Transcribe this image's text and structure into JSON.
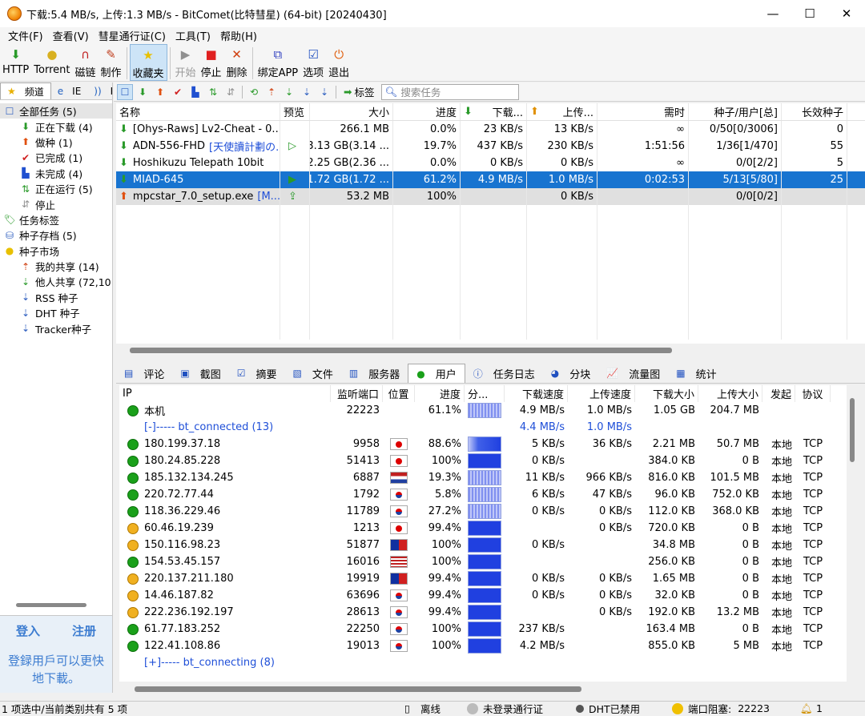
{
  "window": {
    "title": "下载:5.4 MB/s, 上传:1.3 MB/s - BitComet(比特彗星) (64-bit) [20240430]",
    "minimize": "—",
    "maximize": "☐",
    "close": "✕"
  },
  "menu": [
    "文件(F)",
    "查看(V)",
    "彗星通行证(C)",
    "工具(T)",
    "帮助(H)"
  ],
  "toolbar": [
    {
      "label": "HTTP",
      "icon": "http-download-icon",
      "glyph": "⬇",
      "color": "#2a9a2a",
      "state": "normal"
    },
    {
      "label": "Torrent",
      "icon": "torrent-icon",
      "glyph": "●",
      "color": "#d8b020",
      "state": "normal"
    },
    {
      "label": "磁链",
      "icon": "magnet-icon",
      "glyph": "∩",
      "color": "#c02020",
      "state": "normal"
    },
    {
      "label": "制作",
      "icon": "make-torrent-icon",
      "glyph": "✎",
      "color": "#c04020",
      "state": "normal"
    },
    {
      "label": "收藏夹",
      "icon": "favorites-star-icon",
      "glyph": "★",
      "color": "#e8c000",
      "state": "active"
    },
    {
      "label": "开始",
      "icon": "start-icon",
      "glyph": "▶",
      "color": "#909090",
      "state": "disabled"
    },
    {
      "label": "停止",
      "icon": "stop-icon",
      "glyph": "■",
      "color": "#e02020",
      "state": "normal"
    },
    {
      "label": "删除",
      "icon": "delete-icon",
      "glyph": "✕",
      "color": "#d04010",
      "state": "normal"
    },
    {
      "label": "绑定APP",
      "icon": "bind-app-icon",
      "glyph": "⧉",
      "color": "#3040c0",
      "state": "normal"
    },
    {
      "label": "选项",
      "icon": "options-icon",
      "glyph": "☑",
      "color": "#2050c0",
      "state": "normal"
    },
    {
      "label": "退出",
      "icon": "exit-icon",
      "glyph": "⏻",
      "color": "#e06010",
      "state": "normal"
    }
  ],
  "left_tabs": [
    {
      "label": "频道",
      "icon": "star-icon",
      "glyph": "★",
      "sel": true
    },
    {
      "label": "IE",
      "icon": "ie-icon",
      "glyph": "e",
      "sel": false
    },
    {
      "label": "RSS",
      "icon": "rss-icon",
      "glyph": "))",
      "sel": false
    }
  ],
  "tree": [
    {
      "label": "全部任务 (5)",
      "indent": 4,
      "icon": "all-tasks-icon",
      "glyph": "☐",
      "color": "#3060c0",
      "sel": true
    },
    {
      "label": "正在下载 (4)",
      "indent": 24,
      "icon": "downloading-icon",
      "glyph": "⬇",
      "color": "#2a9a2a",
      "sel": false
    },
    {
      "label": "做种 (1)",
      "indent": 24,
      "icon": "seeding-icon",
      "glyph": "⬆",
      "color": "#e05010",
      "sel": false
    },
    {
      "label": "已完成 (1)",
      "indent": 24,
      "icon": "completed-icon",
      "glyph": "✔",
      "color": "#d02020",
      "sel": false
    },
    {
      "label": "未完成 (4)",
      "indent": 24,
      "icon": "incomplete-icon",
      "glyph": "▙",
      "color": "#2050d0",
      "sel": false
    },
    {
      "label": "正在运行 (5)",
      "indent": 24,
      "icon": "running-icon",
      "glyph": "⇅",
      "color": "#2a9a2a",
      "sel": false
    },
    {
      "label": "停止",
      "indent": 24,
      "icon": "stopped-icon",
      "glyph": "⇵",
      "color": "#909090",
      "sel": false
    },
    {
      "label": "任务标签",
      "indent": 4,
      "icon": "task-tag-icon",
      "glyph": "🏷",
      "color": "#2a9a2a",
      "sel": false
    },
    {
      "label": "种子存档 (5)",
      "indent": 4,
      "icon": "torrent-archive-icon",
      "glyph": "⛁",
      "color": "#3060c0",
      "sel": false
    },
    {
      "label": "种子市场",
      "indent": 4,
      "icon": "torrent-market-icon",
      "glyph": "●",
      "color": "#e8c000",
      "sel": false
    },
    {
      "label": "我的共享 (14)",
      "indent": 24,
      "icon": "my-share-icon",
      "glyph": "⇡",
      "color": "#d04010",
      "sel": false
    },
    {
      "label": "他人共享 (72,10",
      "indent": 24,
      "icon": "others-share-icon",
      "glyph": "⇣",
      "color": "#2a9a2a",
      "sel": false
    },
    {
      "label": "RSS 种子",
      "indent": 24,
      "icon": "rss-seeds-icon",
      "glyph": "⇣",
      "color": "#3060c0",
      "sel": false
    },
    {
      "label": "DHT 种子",
      "indent": 24,
      "icon": "dht-seeds-icon",
      "glyph": "⇣",
      "color": "#3060c0",
      "sel": false
    },
    {
      "label": "Tracker种子",
      "indent": 24,
      "icon": "tracker-seeds-icon",
      "glyph": "⇣",
      "color": "#3060c0",
      "sel": false
    }
  ],
  "login": {
    "login": "登入",
    "register": "注册",
    "message": "登録用戶可以更快地下載。"
  },
  "filter_icons": [
    {
      "name": "filter-all-icon",
      "glyph": "☐",
      "color": "#3060c0",
      "sel": true
    },
    {
      "name": "filter-downloading-icon",
      "glyph": "⬇",
      "color": "#2a9a2a",
      "sel": false
    },
    {
      "name": "filter-seeding-icon",
      "glyph": "⬆",
      "color": "#e05010",
      "sel": false
    },
    {
      "name": "filter-completed-icon",
      "glyph": "✔",
      "color": "#d02020",
      "sel": false
    },
    {
      "name": "filter-incomplete-icon",
      "glyph": "▙",
      "color": "#2050d0",
      "sel": false
    },
    {
      "name": "filter-running-icon",
      "glyph": "⇅",
      "color": "#2a9a2a",
      "sel": false
    },
    {
      "name": "filter-stopped-icon",
      "glyph": "⇵",
      "color": "#909090",
      "sel": false
    },
    {
      "name": "filter-share-icon",
      "glyph": "⟲",
      "color": "#2a9a2a",
      "sel": false
    },
    {
      "name": "filter-my-share-icon",
      "glyph": "⇡",
      "color": "#d04010",
      "sel": false
    },
    {
      "name": "filter-others-share-icon",
      "glyph": "⇣",
      "color": "#2a9a2a",
      "sel": false
    },
    {
      "name": "filter-rss-icon",
      "glyph": "⇣",
      "color": "#3060c0",
      "sel": false
    },
    {
      "name": "filter-dht-icon",
      "glyph": "⇣",
      "color": "#3060c0",
      "sel": false
    }
  ],
  "filter_tag": "标签",
  "search": {
    "placeholder": "搜索任务"
  },
  "task_columns": [
    {
      "label": "名称",
      "w": 205,
      "align": "l"
    },
    {
      "label": "预览",
      "w": 37,
      "align": "l"
    },
    {
      "label": "大小",
      "w": 104,
      "align": "r"
    },
    {
      "label": "进度",
      "w": 84,
      "align": "r"
    },
    {
      "label": "下载...",
      "w": 83,
      "align": "r",
      "icon": "⬇"
    },
    {
      "label": "上传...",
      "w": 88,
      "align": "r",
      "icon": "⬆"
    },
    {
      "label": "需时",
      "w": 114,
      "align": "r"
    },
    {
      "label": "种子/用户[总]",
      "w": 116,
      "align": "r"
    },
    {
      "label": "长效种子",
      "w": 82,
      "align": "r"
    }
  ],
  "tasks": [
    {
      "name": "[Ohys-Raws] Lv2-Cheat - 0...",
      "tag": "",
      "preview": "",
      "size": "266.1 MB",
      "progress": "0.0%",
      "down": "23 KB/s",
      "up": "13 KB/s",
      "eta": "∞",
      "seeds": "0/50[0/3006]",
      "long": "0",
      "icon": "⬇",
      "iconcolor": "#2a9a2a",
      "state": ""
    },
    {
      "name": "ADN-556-FHD",
      "tag": "[天使讀計劃の...",
      "preview": "▷",
      "size": "3.13 GB(3.14 ...",
      "progress": "19.7%",
      "down": "437 KB/s",
      "up": "230 KB/s",
      "eta": "1:51:56",
      "seeds": "1/36[1/470]",
      "long": "55",
      "icon": "⬇",
      "iconcolor": "#2a9a2a",
      "state": ""
    },
    {
      "name": "Hoshikuzu Telepath 10bit",
      "tag": "",
      "preview": "",
      "size": "2.25 GB(2.36 ...",
      "progress": "0.0%",
      "down": "0 KB/s",
      "up": "0 KB/s",
      "eta": "∞",
      "seeds": "0/0[2/2]",
      "long": "5",
      "icon": "⬇",
      "iconcolor": "#2a9a2a",
      "state": ""
    },
    {
      "name": "MIAD-645",
      "tag": "",
      "preview": "▶",
      "size": "1.72 GB(1.72 ...",
      "progress": "61.2%",
      "down": "4.9 MB/s",
      "up": "1.0 MB/s",
      "eta": "0:02:53",
      "seeds": "5/13[5/80]",
      "long": "25",
      "icon": "⬇",
      "iconcolor": "#2a9a2a",
      "state": "sel"
    },
    {
      "name": "mpcstar_7.0_setup.exe",
      "tag": "[M...",
      "preview": "⇪",
      "size": "53.2 MB",
      "progress": "100%",
      "down": "",
      "up": "0 KB/s",
      "eta": "",
      "seeds": "0/0[0/2]",
      "long": "",
      "icon": "⬆",
      "iconcolor": "#e05010",
      "state": "sel2"
    }
  ],
  "detail_tabs": [
    {
      "label": "评论",
      "icon": "comment-icon",
      "glyph": "▤"
    },
    {
      "label": "截图",
      "icon": "screenshot-icon",
      "glyph": "▣"
    },
    {
      "label": "摘要",
      "icon": "summary-icon",
      "glyph": "☑"
    },
    {
      "label": "文件",
      "icon": "files-icon",
      "glyph": "▧"
    },
    {
      "label": "服务器",
      "icon": "servers-icon",
      "glyph": "▥"
    },
    {
      "label": "用户",
      "icon": "peers-icon",
      "glyph": "●",
      "sel": true
    },
    {
      "label": "任务日志",
      "icon": "task-log-icon",
      "glyph": "ⓘ"
    },
    {
      "label": "分块",
      "icon": "pieces-icon",
      "glyph": "◕"
    },
    {
      "label": "流量图",
      "icon": "traffic-graph-icon",
      "glyph": "📈"
    },
    {
      "label": "统计",
      "icon": "statistics-icon",
      "glyph": "▦"
    }
  ],
  "peer_columns": [
    {
      "label": "IP",
      "w": 264,
      "align": "l"
    },
    {
      "label": "监听端口",
      "w": 65,
      "align": "r"
    },
    {
      "label": "位置",
      "w": 40,
      "align": "c"
    },
    {
      "label": "进度",
      "w": 62,
      "align": "r"
    },
    {
      "label": "分...",
      "w": 50,
      "align": "l"
    },
    {
      "label": "下载速度",
      "w": 79,
      "align": "r"
    },
    {
      "label": "上传速度",
      "w": 84,
      "align": "r"
    },
    {
      "label": "下载大小",
      "w": 79,
      "align": "r"
    },
    {
      "label": "上传大小",
      "w": 80,
      "align": "r"
    },
    {
      "label": "发起",
      "w": 41,
      "align": "r"
    },
    {
      "label": "协议",
      "w": 44,
      "align": "c"
    }
  ],
  "peers": [
    {
      "type": "self",
      "dot": "g",
      "ip": "本机",
      "port": "22223",
      "flag": "",
      "progress": "61.1%",
      "dist": "light",
      "down": "4.9 MB/s",
      "up": "1.0 MB/s",
      "dsize": "1.05 GB",
      "usize": "204.7 MB",
      "init": "",
      "proto": ""
    },
    {
      "type": "group",
      "ip": "[-]----- bt_connected (13)",
      "down": "4.4 MB/s",
      "up": "1.0 MB/s"
    },
    {
      "type": "peer",
      "dot": "g",
      "ip": "180.199.37.18",
      "port": "9958",
      "flag": "JP",
      "progress": "88.6%",
      "dist": "partial",
      "down": "5 KB/s",
      "up": "36 KB/s",
      "dsize": "2.21 MB",
      "usize": "50.7 MB",
      "init": "本地",
      "proto": "TCP"
    },
    {
      "type": "peer",
      "dot": "g",
      "ip": "180.24.85.228",
      "port": "51413",
      "flag": "JP",
      "progress": "100%",
      "dist": "full",
      "down": "0 KB/s",
      "up": "",
      "dsize": "384.0 KB",
      "usize": "0 B",
      "init": "本地",
      "proto": "TCP"
    },
    {
      "type": "peer",
      "dot": "g",
      "ip": "185.132.134.245",
      "port": "6887",
      "flag": "NL",
      "progress": "19.3%",
      "dist": "light",
      "down": "11 KB/s",
      "up": "966 KB/s",
      "dsize": "816.0 KB",
      "usize": "101.5 MB",
      "init": "本地",
      "proto": "TCP"
    },
    {
      "type": "peer",
      "dot": "g",
      "ip": "220.72.77.44",
      "port": "1792",
      "flag": "KR",
      "progress": "5.8%",
      "dist": "light",
      "down": "6 KB/s",
      "up": "47 KB/s",
      "dsize": "96.0 KB",
      "usize": "752.0 KB",
      "init": "本地",
      "proto": "TCP"
    },
    {
      "type": "peer",
      "dot": "g",
      "ip": "118.36.229.46",
      "port": "11789",
      "flag": "KR",
      "progress": "27.2%",
      "dist": "light",
      "down": "0 KB/s",
      "up": "0 KB/s",
      "dsize": "112.0 KB",
      "usize": "368.0 KB",
      "init": "本地",
      "proto": "TCP"
    },
    {
      "type": "peer",
      "dot": "y",
      "ip": "60.46.19.239",
      "port": "1213",
      "flag": "JP",
      "progress": "99.4%",
      "dist": "full",
      "down": "",
      "up": "0 KB/s",
      "dsize": "720.0 KB",
      "usize": "0 B",
      "init": "本地",
      "proto": "TCP"
    },
    {
      "type": "peer",
      "dot": "y",
      "ip": "150.116.98.23",
      "port": "51877",
      "flag": "TW",
      "progress": "100%",
      "dist": "full",
      "down": "0 KB/s",
      "up": "",
      "dsize": "34.8 MB",
      "usize": "0 B",
      "init": "本地",
      "proto": "TCP"
    },
    {
      "type": "peer",
      "dot": "g",
      "ip": "154.53.45.157",
      "port": "16016",
      "flag": "US",
      "progress": "100%",
      "dist": "full",
      "down": "",
      "up": "",
      "dsize": "256.0 KB",
      "usize": "0 B",
      "init": "本地",
      "proto": "TCP"
    },
    {
      "type": "peer",
      "dot": "y",
      "ip": "220.137.211.180",
      "port": "19919",
      "flag": "TW",
      "progress": "99.4%",
      "dist": "full",
      "down": "0 KB/s",
      "up": "0 KB/s",
      "dsize": "1.65 MB",
      "usize": "0 B",
      "init": "本地",
      "proto": "TCP"
    },
    {
      "type": "peer",
      "dot": "y",
      "ip": "14.46.187.82",
      "port": "63696",
      "flag": "KR",
      "progress": "99.4%",
      "dist": "full",
      "down": "0 KB/s",
      "up": "0 KB/s",
      "dsize": "32.0 KB",
      "usize": "0 B",
      "init": "本地",
      "proto": "TCP"
    },
    {
      "type": "peer",
      "dot": "y",
      "ip": "222.236.192.197",
      "port": "28613",
      "flag": "KR",
      "progress": "99.4%",
      "dist": "full",
      "down": "",
      "up": "0 KB/s",
      "dsize": "192.0 KB",
      "usize": "13.2 MB",
      "init": "本地",
      "proto": "TCP"
    },
    {
      "type": "peer",
      "dot": "g",
      "ip": "61.77.183.252",
      "port": "22250",
      "flag": "KR",
      "progress": "100%",
      "dist": "full",
      "down": "237 KB/s",
      "up": "",
      "dsize": "163.4 MB",
      "usize": "0 B",
      "init": "本地",
      "proto": "TCP"
    },
    {
      "type": "peer",
      "dot": "g",
      "ip": "122.41.108.86",
      "port": "19013",
      "flag": "KR",
      "progress": "100%",
      "dist": "full",
      "down": "4.2 MB/s",
      "up": "",
      "dsize": "855.0 KB",
      "usize": "5 MB",
      "init": "本地",
      "proto": "TCP"
    },
    {
      "type": "group",
      "ip": "[+]----- bt_connecting (8)",
      "down": "",
      "up": ""
    }
  ],
  "status": {
    "selection": "1 项选中/当前类别共有 5 项",
    "offline": "离线",
    "passport": "未登录通行证",
    "dht": "DHT已禁用",
    "port_blocked": "端口阻塞:",
    "port": "22223",
    "alerts": "1"
  },
  "colors": {
    "selected_row": "#1874d0",
    "link_blue": "#3c7cd0"
  }
}
